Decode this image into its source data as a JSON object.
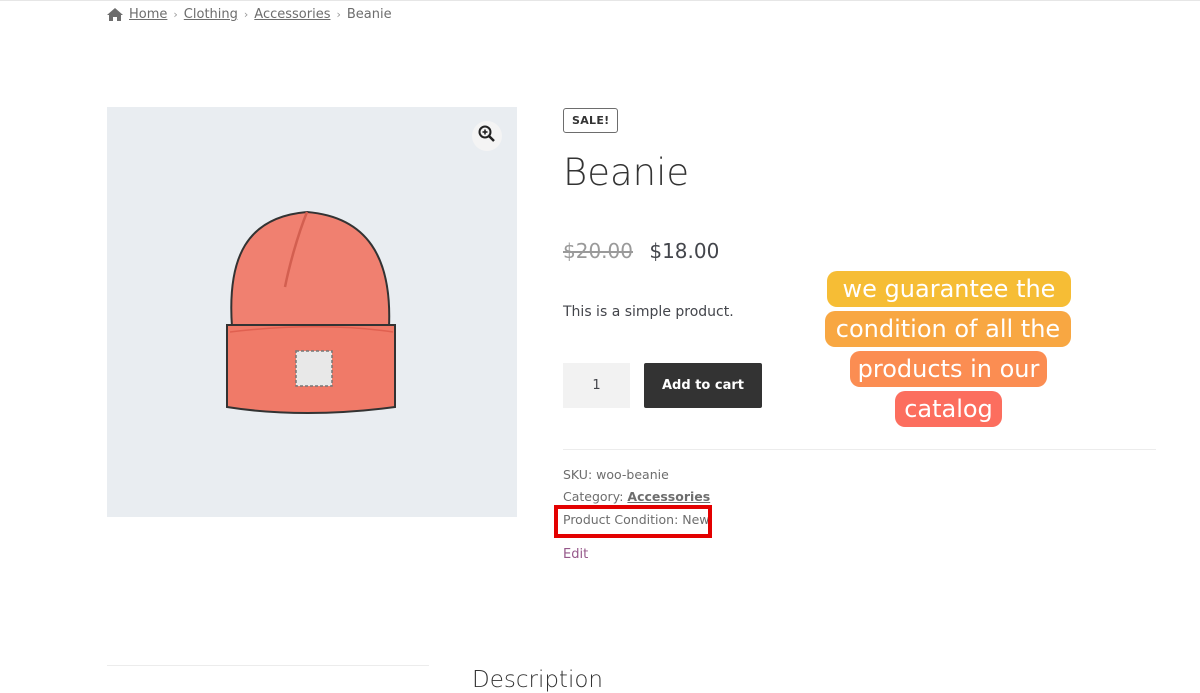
{
  "breadcrumb": {
    "items": [
      "Home",
      "Clothing",
      "Accessories"
    ],
    "current": "Beanie"
  },
  "product": {
    "badge": "SALE!",
    "title": "Beanie",
    "old_price": "$20.00",
    "price": "$18.00",
    "short_description": "This is a simple product.",
    "quantity": "1",
    "add_to_cart_label": "Add to cart",
    "sku_label": "SKU:",
    "sku_value": "woo-beanie",
    "category_label": "Category:",
    "category_value": "Accessories",
    "condition_text": "Product Condition: New",
    "edit_label": "Edit"
  },
  "promo": {
    "lines": [
      "we guarantee the",
      "condition of all the",
      "products in our",
      "catalog"
    ]
  },
  "tabs": {
    "description_label": "Description"
  },
  "colors": {
    "accent_link": "#96588a",
    "button_bg": "#333333",
    "highlight": "#e30000",
    "gallery_bg": "#e9edf1"
  }
}
